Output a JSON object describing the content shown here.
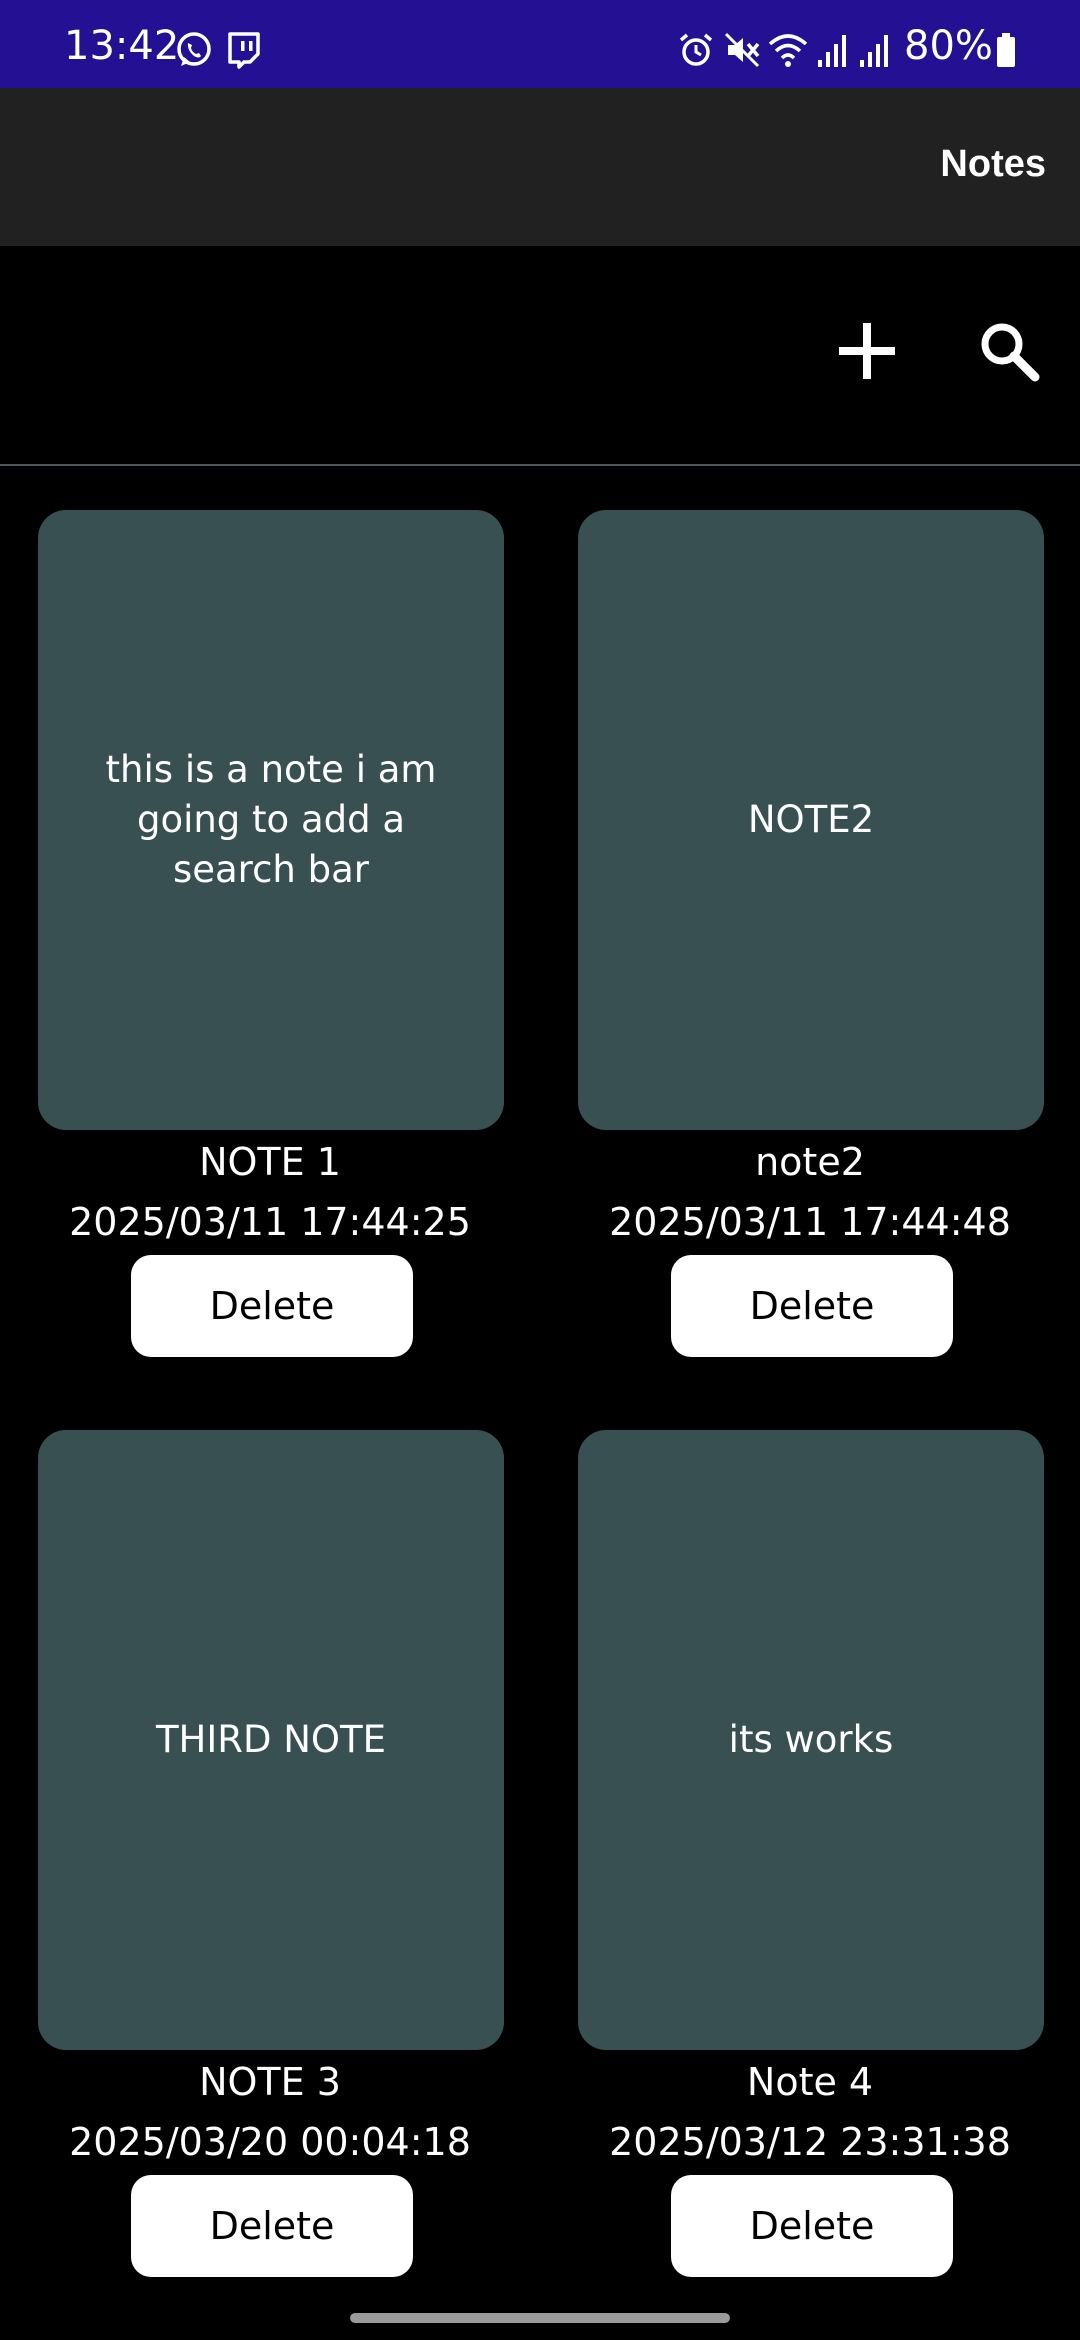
{
  "status_bar": {
    "time": "13:42",
    "battery": "80%",
    "background": "#231093",
    "icons_left": [
      "whatsapp-icon",
      "twitch-icon"
    ],
    "icons_right": [
      "alarm-icon",
      "mute-icon",
      "wifi-icon",
      "signal-icon",
      "signal-icon",
      "battery-icon"
    ]
  },
  "app_bar": {
    "title": "Notes",
    "background": "#212121"
  },
  "toolbar": {
    "add_icon": "plus-icon",
    "search_icon": "search-icon"
  },
  "notes": [
    {
      "preview": "this is a note i am going to add a search bar",
      "title": "NOTE 1",
      "date": "2025/03/11 17:44:25",
      "delete_label": "Delete"
    },
    {
      "preview": "NOTE2",
      "title": "note2",
      "date": "2025/03/11 17:44:48",
      "delete_label": "Delete"
    },
    {
      "preview": "THIRD NOTE",
      "title": "NOTE 3",
      "date": "2025/03/20 00:04:18",
      "delete_label": "Delete"
    },
    {
      "preview": "its works",
      "title": "Note 4",
      "date": "2025/03/12 23:31:38",
      "delete_label": "Delete"
    }
  ],
  "colors": {
    "card": "#385051",
    "background": "#000000",
    "button": "#ffffff"
  }
}
